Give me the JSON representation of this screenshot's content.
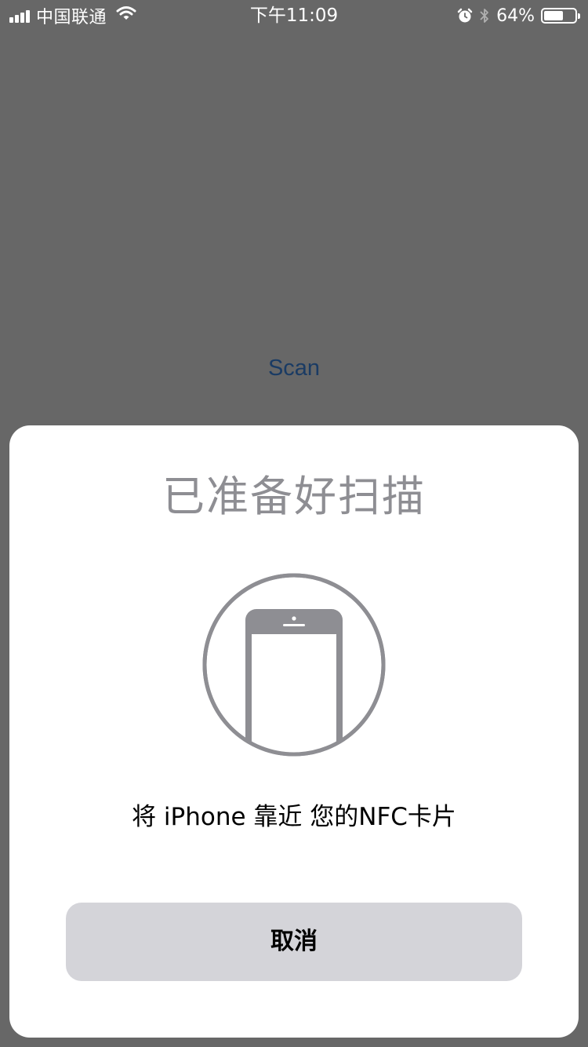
{
  "status_bar": {
    "carrier": "中国联通",
    "time": "下午11:09",
    "battery_percent": "64%",
    "battery_level": 0.64,
    "icons": [
      "signal-icon",
      "wifi-icon",
      "alarm-icon",
      "bluetooth-icon",
      "battery-icon"
    ]
  },
  "background": {
    "scan_label": "Scan",
    "scan_color": "#1a3b64",
    "overlay_color": "#676767"
  },
  "sheet": {
    "title": "已准备好扫描",
    "message": "将 iPhone 靠近 您的NFC卡片",
    "cancel_label": "取消",
    "illustration": "phone-icon",
    "title_color": "#8e8e93",
    "button_color": "#d4d4d9"
  }
}
